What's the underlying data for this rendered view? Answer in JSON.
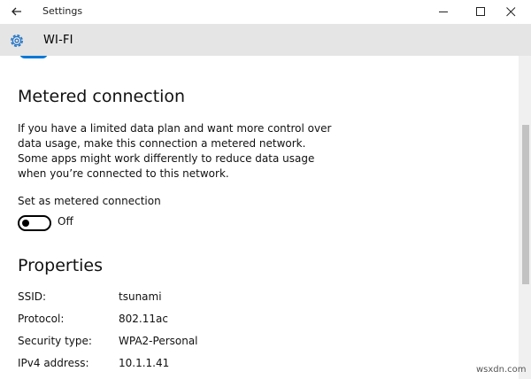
{
  "window": {
    "title": "Settings",
    "back_icon": "back-arrow-icon",
    "controls": [
      "minimize-icon",
      "maximize-icon",
      "close-icon"
    ]
  },
  "header": {
    "icon": "gear-icon",
    "title": "WI-FI"
  },
  "metered": {
    "heading": "Metered connection",
    "description": "If you have a limited data plan and want more control over data usage, make this connection a metered network. Some apps might work differently to reduce data usage when you’re connected to this network.",
    "toggle_label": "Set as metered connection",
    "toggle_state": "Off",
    "toggle_on": false
  },
  "properties": {
    "heading": "Properties",
    "rows": [
      {
        "label": "SSID:",
        "value": "tsunami"
      },
      {
        "label": "Protocol:",
        "value": "802.11ac"
      },
      {
        "label": "Security type:",
        "value": "WPA2-Personal"
      },
      {
        "label": "IPv4 address:",
        "value": "10.1.1.41"
      }
    ]
  },
  "watermark": "wsxdn.com",
  "colors": {
    "accent": "#0078d7",
    "header_bg": "#e5e5e5",
    "gear_blue": "#1a6fc4"
  }
}
